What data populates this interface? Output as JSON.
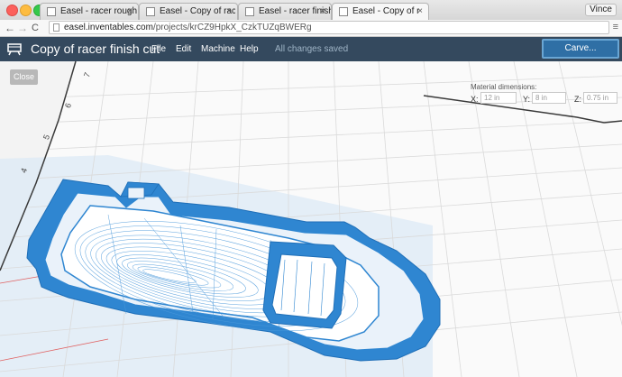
{
  "browser": {
    "tabs": [
      {
        "label": "Easel - racer rough cut",
        "active": false
      },
      {
        "label": "Easel - Copy of racer rough",
        "active": false
      },
      {
        "label": "Easel - racer finish cut",
        "active": false
      },
      {
        "label": "Easel - Copy of racer finish",
        "active": true
      }
    ],
    "close_glyph": "×",
    "user": "Vince",
    "url_host": "easel.inventables.com",
    "url_path": "/projects/krCZ9HpkX_CzkTUZqBWERg",
    "back": "←",
    "forward": "→",
    "reload": "C"
  },
  "app": {
    "title": "Copy of racer finish cut",
    "menu": [
      "File",
      "Edit",
      "Machine",
      "Help"
    ],
    "save_status": "All changes saved",
    "carve_label": "Carve..."
  },
  "workspace": {
    "close_label": "Close",
    "material": {
      "label": "Material dimensions:",
      "x_label": "X:",
      "x_value": "12 in",
      "y_label": "Y:",
      "y_value": "8 in",
      "z_label": "Z:",
      "z_value": "0.75 in"
    },
    "axis_labels": [
      "7",
      "6",
      "5",
      "4"
    ],
    "colors": {
      "toolpath": "#2f86d1",
      "material_edge": "#3a3a3a",
      "grid": "#dcdcdc",
      "header": "#34495e"
    }
  }
}
